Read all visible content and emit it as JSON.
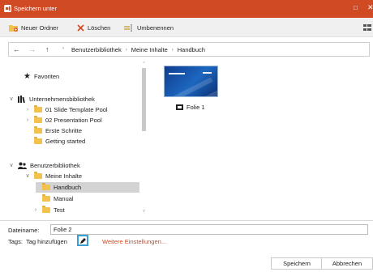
{
  "window": {
    "title": "Speichern unter",
    "accent": "#d04a23",
    "title_icon": "app-logo-icon",
    "controls": [
      "maximize-icon",
      "close-icon"
    ]
  },
  "toolbar": {
    "new_folder": "Neuer Ordner",
    "delete": "Löschen",
    "rename": "Umbenennen",
    "view_icon": "grid-view-icon"
  },
  "navigation": {
    "back_icon": "back-arrow-icon",
    "forward_icon": "forward-arrow-icon",
    "up_icon": "up-arrow-icon",
    "breadcrumbs": [
      "Benutzerbibliothek",
      "Meine Inhalte",
      "Handbuch"
    ]
  },
  "tree": {
    "favorites": "Favoriten",
    "company_library": "Unternehmensbibliothek",
    "company_items": [
      "01 Slide Template Pool",
      "02 Presentation Pool",
      "Erste Schritte",
      "Getting started"
    ],
    "user_library": "Benutzerbibliothek",
    "my_content": "Meine Inhalte",
    "my_content_items": [
      "Handbuch",
      "Manual",
      "Test"
    ]
  },
  "files": [
    {
      "name": "Folie 1"
    }
  ],
  "form": {
    "filename_label": "Dateiname:",
    "filename_value": "Folie 2",
    "tags_label": "Tags:",
    "add_tag": "Tag hinzufügen",
    "more_settings": "Weitere Einstellungen...",
    "save": "Speichern",
    "cancel": "Abbrechen"
  }
}
